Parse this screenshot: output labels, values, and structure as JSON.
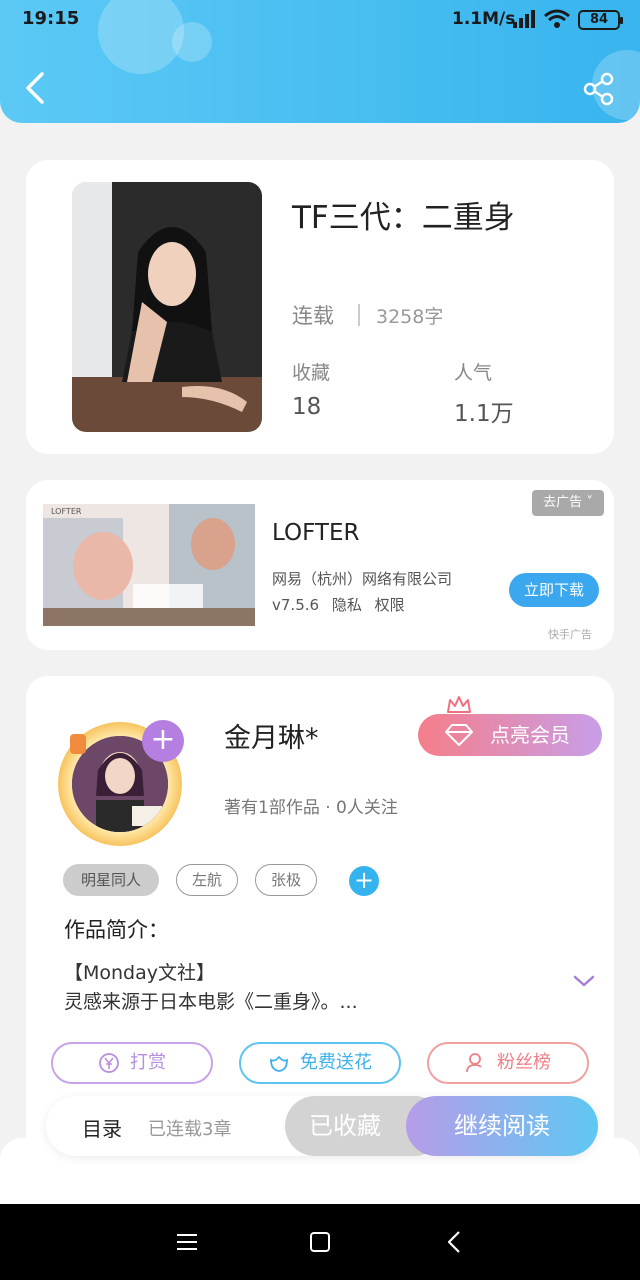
{
  "status_bar": {
    "time": "19:15",
    "speed": "1.1M/s",
    "battery": "84"
  },
  "book": {
    "title": "TF三代：二重身",
    "status": "连载",
    "word_count": "3258字",
    "favorites_label": "收藏",
    "favorites_value": "18",
    "popularity_label": "人气",
    "popularity_value": "1.1万"
  },
  "ad": {
    "title": "LOFTER",
    "company": "网易（杭州）网络有限公司",
    "version": "v7.5.6",
    "privacy": "隐私",
    "permissions": "权限",
    "close_label": "去广告",
    "download_label": "立即下载",
    "source": "快手广告"
  },
  "author": {
    "name": "金月琳*",
    "vip_label": "点亮会员",
    "meta": "著有1部作品 · 0人关注",
    "tags": [
      "明星同人",
      "左航",
      "张极"
    ],
    "intro_label": "作品简介：",
    "intro_line1": "【Monday文社】",
    "intro_line2": "灵感来源于日本电影《二重身》。...",
    "actions": {
      "reward": "打赏",
      "flower": "免费送花",
      "fans": "粉丝榜"
    }
  },
  "bottom": {
    "toc": "目录",
    "chapters": "已连载3章",
    "collected": "已收藏",
    "continue": "继续阅读"
  },
  "colors": {
    "header": "#38b4ee",
    "accent_purple": "#b47fe0",
    "accent_blue": "#35b3ef",
    "accent_red": "#f57e8a"
  }
}
